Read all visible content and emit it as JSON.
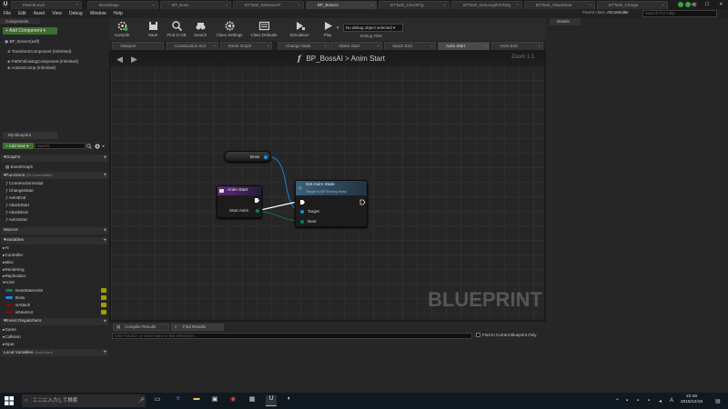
{
  "titlebar": {
    "tabs": [
      {
        "label": "ParentLevel",
        "active": false
      },
      {
        "label": "BossStage",
        "active": false
      },
      {
        "label": "BT_Boss",
        "active": false
      },
      {
        "label": "BTTask_SetNextAP",
        "active": false
      },
      {
        "label": "BP_BossAI",
        "active": true
      },
      {
        "label": "BTTask_CheckFig",
        "active": false
      },
      {
        "label": "BTTask_GetLengthToTarg",
        "active": false
      },
      {
        "label": "BTTask_AttackNear",
        "active": false
      },
      {
        "label": "BTTask_Charge",
        "active": false
      }
    ],
    "window_buttons": [
      "—",
      "☐",
      "✕"
    ]
  },
  "menubar": {
    "items": [
      "File",
      "Edit",
      "Asset",
      "View",
      "Debug",
      "Window",
      "Help"
    ],
    "parent_class_label": "Parent class:",
    "parent_class_value": "AIController",
    "help_search_placeholder": "Search For Help"
  },
  "components": {
    "tab": "Components",
    "add_button": "+ Add Component ▾",
    "items": [
      "BP_BossAI(self)",
      "TransformComponent (Inherited)",
      "PathFollowingComponent (Inherited)",
      "ActionsComp (Inherited)"
    ]
  },
  "my_blueprint": {
    "tab": "My Blueprint",
    "add_new": "+ Add New ▾",
    "search_placeholder": "Search",
    "graphs_label": "Graphs",
    "graphs": [
      "EventGraph"
    ],
    "functions_label": "Functions",
    "functions_count": "(20 Overridable)",
    "functions": [
      "ConstructionScript",
      "ChangeState",
      "AnimEnd",
      "AttackStart",
      "AttackEnd",
      "AnimStart"
    ],
    "macros_label": "Macros",
    "variables_label": "Variables",
    "variable_categories": [
      "AI",
      "Controller",
      "Misc",
      "Rendering",
      "Replication",
      "Actor"
    ],
    "variables": [
      {
        "name": "NowStateAnim",
        "color": "#0f7a5a"
      },
      {
        "name": "Boss",
        "color": "#1e8ad6"
      },
      {
        "name": "isAttack",
        "color": "#7a0c0c"
      },
      {
        "name": "isNextAct",
        "color": "#7a0c0c"
      }
    ],
    "event_dispatchers_label": "Event Dispatchers",
    "event_dispatcher_categories": [
      "Game",
      "Collision",
      "Input"
    ],
    "local_variables_label": "Local Variables",
    "local_variables_scope": "(AnimStart)"
  },
  "toolbar": {
    "buttons": [
      "Compile",
      "Save",
      "Find in CB",
      "Search",
      "Class Settings",
      "Class Defaults",
      "Simulation",
      "Play"
    ],
    "debug_select": "No debug object selected ▾",
    "debug_label": "Debug Filter"
  },
  "graph_tabs": [
    {
      "label": "Viewport",
      "active": false
    },
    {
      "label": "Construction Scri",
      "active": false
    },
    {
      "label": "Event Graph",
      "active": false
    },
    {
      "label": "Change State",
      "active": false
    },
    {
      "label": "Attack Start",
      "active": false
    },
    {
      "label": "Attack End",
      "active": false
    },
    {
      "label": "Anim Start",
      "active": true
    },
    {
      "label": "Anim End",
      "active": false
    }
  ],
  "graph": {
    "breadcrumb_icon": "f",
    "breadcrumb_root": "BP_BossAI",
    "breadcrumb_sep": ">",
    "breadcrumb_current": "Anim Start",
    "zoom": "Zoom 1:1",
    "watermark": "BLUEPRINT",
    "nodes": {
      "boss_var": {
        "label": "Boss"
      },
      "entry": {
        "title": "Anim Start",
        "pin": "Start Anim"
      },
      "call": {
        "title": "Set Anim State",
        "subtitle": "Target is BP Enemy Boss",
        "pin_target": "Target",
        "pin_next": "Next"
      }
    },
    "colors": {
      "entry_header": "#5a2a7a",
      "call_header": "#3a5f7a",
      "object_pin": "#1e8ad6",
      "byte_pin": "#0f7a5a",
      "exec": "#ffffff"
    }
  },
  "bottom": {
    "tabs": [
      "Compiler Results",
      "Find Results"
    ],
    "find_placeholder": "Enter function or event name to find references...",
    "find_only_label": "Find In Current Blueprint Only"
  },
  "details": {
    "tab": "Details"
  },
  "taskbar": {
    "search_text": "ここに入力して検索",
    "time": "22:49",
    "date": "2016/12/18"
  }
}
